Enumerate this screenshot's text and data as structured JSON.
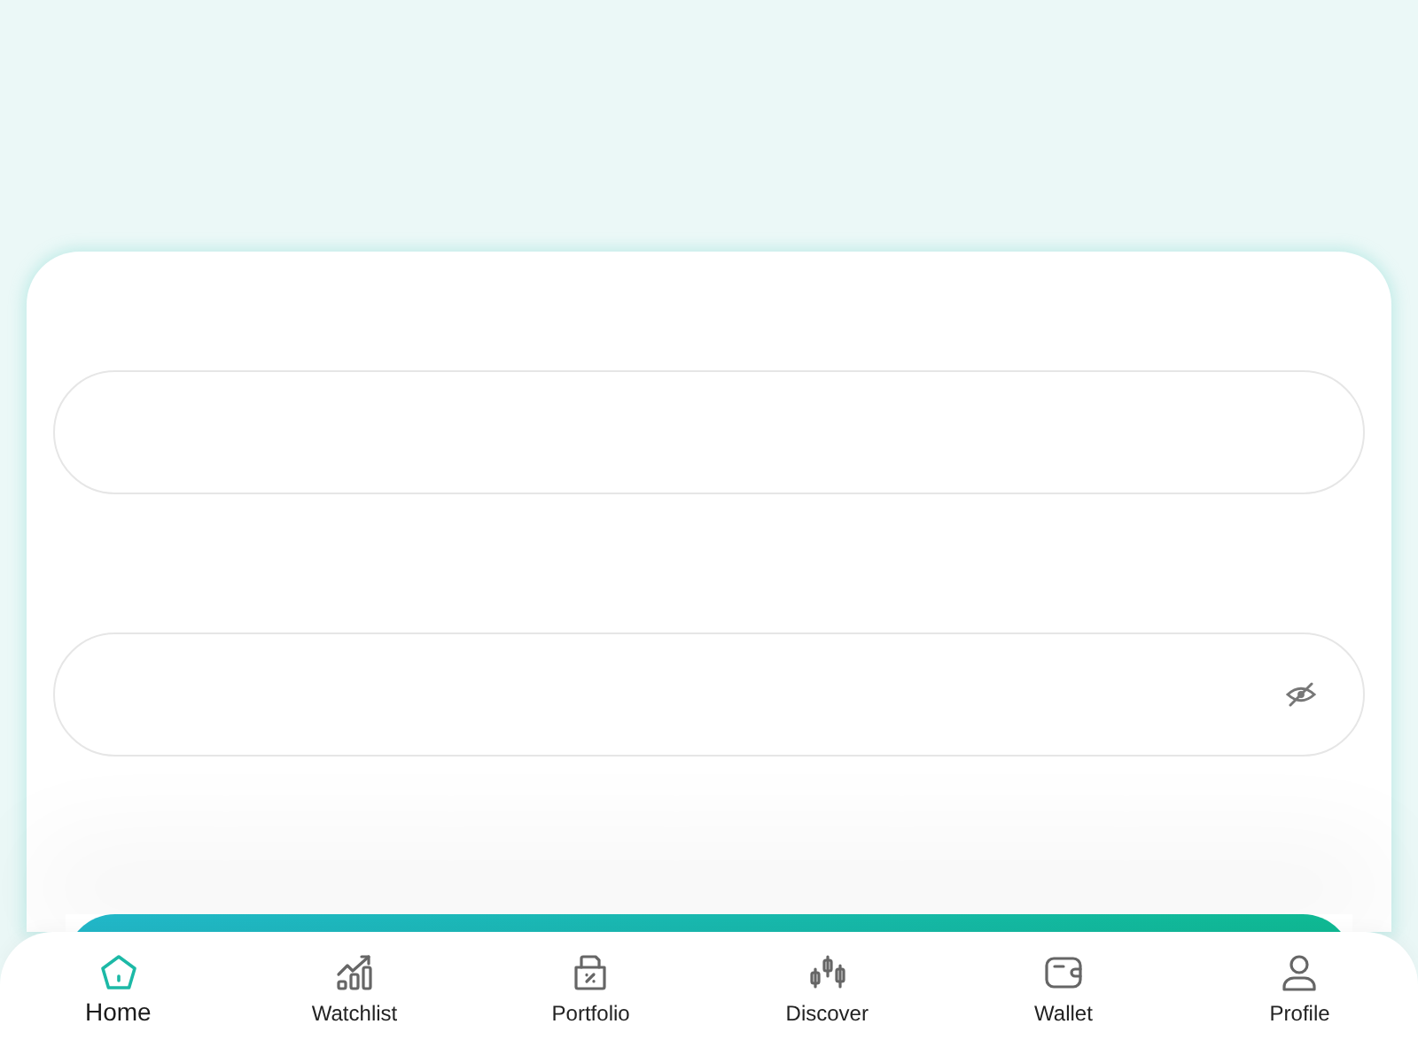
{
  "form": {
    "fields": [
      {
        "kind": "text"
      },
      {
        "kind": "password",
        "masked": true
      }
    ]
  },
  "nav": [
    {
      "label": "Home",
      "kind": "home",
      "selected": true
    },
    {
      "label": "Watchlist",
      "kind": "chart",
      "selected": false
    },
    {
      "label": "Portfolio",
      "kind": "folder",
      "selected": false
    },
    {
      "label": "Discover",
      "kind": "candles",
      "selected": false
    },
    {
      "label": "Wallet",
      "kind": "wallet",
      "selected": false
    },
    {
      "label": "Profile",
      "kind": "person",
      "selected": false
    }
  ]
}
